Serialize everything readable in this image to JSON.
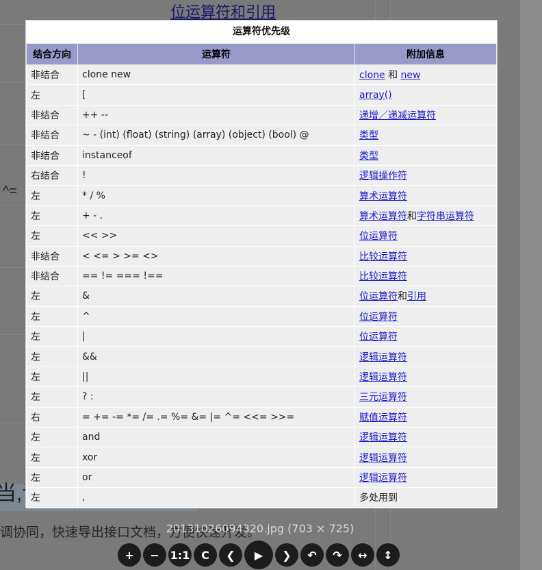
{
  "background": {
    "top_link_a": "位运算符",
    "top_and": "和",
    "top_link_b": "引用",
    "caret_text": "^=",
    "heading_fragment": "当,订",
    "footer_fragment": "调协同，快速导出接口文档，方便快速开发。"
  },
  "table": {
    "caption": "运算符优先级",
    "headers": [
      "结合方向",
      "运算符",
      "附加信息"
    ],
    "rows": [
      {
        "assoc": "非结合",
        "ops": "clone new",
        "info": [
          {
            "t": "clone",
            "link": true
          },
          {
            "t": " 和 ",
            "link": false
          },
          {
            "t": "new",
            "link": true
          }
        ]
      },
      {
        "assoc": "左",
        "ops": "[",
        "info": [
          {
            "t": "array()",
            "link": true
          }
        ]
      },
      {
        "assoc": "非结合",
        "ops": "++ --",
        "info": [
          {
            "t": "递增／递减运算符",
            "link": true
          }
        ]
      },
      {
        "assoc": "非结合",
        "ops": "~ - (int) (float) (string) (array) (object) (bool) @",
        "info": [
          {
            "t": "类型",
            "link": true
          }
        ]
      },
      {
        "assoc": "非结合",
        "ops": "instanceof",
        "info": [
          {
            "t": "类型",
            "link": true
          }
        ]
      },
      {
        "assoc": "右结合",
        "ops": "!",
        "info": [
          {
            "t": "逻辑操作符",
            "link": true
          }
        ]
      },
      {
        "assoc": "左",
        "ops": "* / %",
        "info": [
          {
            "t": "算术运算符",
            "link": true
          }
        ]
      },
      {
        "assoc": "左",
        "ops": "+ - .",
        "info": [
          {
            "t": "算术运算符",
            "link": true
          },
          {
            "t": "和",
            "link": false
          },
          {
            "t": "字符串运算符",
            "link": true
          }
        ]
      },
      {
        "assoc": "左",
        "ops": "<< >>",
        "info": [
          {
            "t": "位运算符",
            "link": true
          }
        ]
      },
      {
        "assoc": "非结合",
        "ops": "< <= > >= <>",
        "info": [
          {
            "t": "比较运算符",
            "link": true
          }
        ]
      },
      {
        "assoc": "非结合",
        "ops": "== != === !==",
        "info": [
          {
            "t": "比较运算符",
            "link": true
          }
        ]
      },
      {
        "assoc": "左",
        "ops": "&",
        "info": [
          {
            "t": "位运算符",
            "link": true
          },
          {
            "t": "和",
            "link": false
          },
          {
            "t": "引用",
            "link": true
          }
        ]
      },
      {
        "assoc": "左",
        "ops": "^",
        "info": [
          {
            "t": "位运算符",
            "link": true
          }
        ]
      },
      {
        "assoc": "左",
        "ops": "|",
        "info": [
          {
            "t": "位运算符",
            "link": true
          }
        ]
      },
      {
        "assoc": "左",
        "ops": "&&",
        "info": [
          {
            "t": "逻辑运算符",
            "link": true
          }
        ]
      },
      {
        "assoc": "左",
        "ops": "||",
        "info": [
          {
            "t": "逻辑运算符",
            "link": true
          }
        ]
      },
      {
        "assoc": "左",
        "ops": "? :",
        "info": [
          {
            "t": "三元运算符",
            "link": true
          }
        ]
      },
      {
        "assoc": "右",
        "ops": "= += -= *= /= .= %= &= |= ^= <<= >>=",
        "info": [
          {
            "t": "赋值运算符",
            "link": true
          }
        ]
      },
      {
        "assoc": "左",
        "ops": "and",
        "info": [
          {
            "t": "逻辑运算符",
            "link": true
          }
        ]
      },
      {
        "assoc": "左",
        "ops": "xor",
        "info": [
          {
            "t": "逻辑运算符",
            "link": true
          }
        ]
      },
      {
        "assoc": "左",
        "ops": "or",
        "info": [
          {
            "t": "逻辑运算符",
            "link": true
          }
        ]
      },
      {
        "assoc": "左",
        "ops": ",",
        "info": [
          {
            "t": "多处用到",
            "link": false
          }
        ]
      }
    ]
  },
  "viewer": {
    "caption": "20131026094320.jpg (703 × 725)",
    "toolbar": [
      {
        "name": "zoom-in-button",
        "glyph": "+"
      },
      {
        "name": "zoom-out-button",
        "glyph": "−"
      },
      {
        "name": "actual-size-button",
        "glyph": "1:1"
      },
      {
        "name": "reset-button",
        "glyph": "C"
      },
      {
        "name": "previous-button",
        "glyph": "❮"
      },
      {
        "name": "play-button",
        "glyph": "▶"
      },
      {
        "name": "next-button",
        "glyph": "❯"
      },
      {
        "name": "rotate-left-button",
        "glyph": "↶"
      },
      {
        "name": "rotate-right-button",
        "glyph": "↷"
      },
      {
        "name": "flip-horizontal-button",
        "glyph": "↔"
      },
      {
        "name": "flip-vertical-button",
        "glyph": "↕"
      }
    ]
  },
  "colors": {
    "header_bg": "#9999cc",
    "cell_bg": "#eeeeee",
    "link": "#1a1ac8",
    "overlay": "#6f6f6f"
  }
}
